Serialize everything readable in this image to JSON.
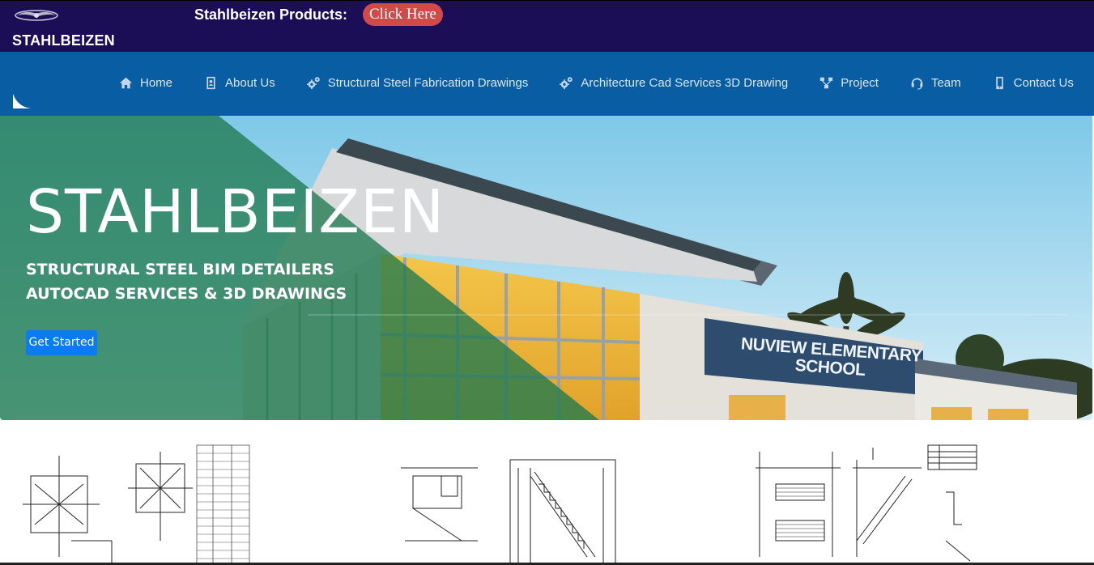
{
  "topbar": {
    "brand": "STAHLBEIZEN",
    "products_label": "Stahlbeizen Products:",
    "click_label": "Click Here",
    "background": "#1b0e57",
    "button_color": "#d14a4a"
  },
  "nav": {
    "background": "#095ea3",
    "items": [
      {
        "label": "Home",
        "icon": "home-icon"
      },
      {
        "label": "About Us",
        "icon": "contact-card-icon"
      },
      {
        "label": "Structural Steel Fabrication Drawings",
        "icon": "gears-icon"
      },
      {
        "label": "Architecture Cad Services 3D Drawing",
        "icon": "gears-icon"
      },
      {
        "label": "Project",
        "icon": "sitemap-icon"
      },
      {
        "label": "Team",
        "icon": "headset-icon"
      },
      {
        "label": "Contact Us",
        "icon": "mobile-icon"
      }
    ]
  },
  "hero": {
    "title": "STAHLBEIZEN",
    "subtitle_line1": "STRUCTURAL STEEL BIM DETAILERS",
    "subtitle_line2": "AUTOCAD SERVICES & 3D DRAWINGS",
    "cta_label": "Get Started",
    "sign_line1": "NUVIEW ELEMENTARY",
    "sign_line2": "SCHOOL",
    "overlay_color": "#1f7a4f",
    "button_color": "#0a7bf0"
  },
  "drawings": [
    {
      "name": "steel-connection-drawing"
    },
    {
      "name": "stair-detail-drawing"
    },
    {
      "name": "stair-section-drawing"
    }
  ]
}
